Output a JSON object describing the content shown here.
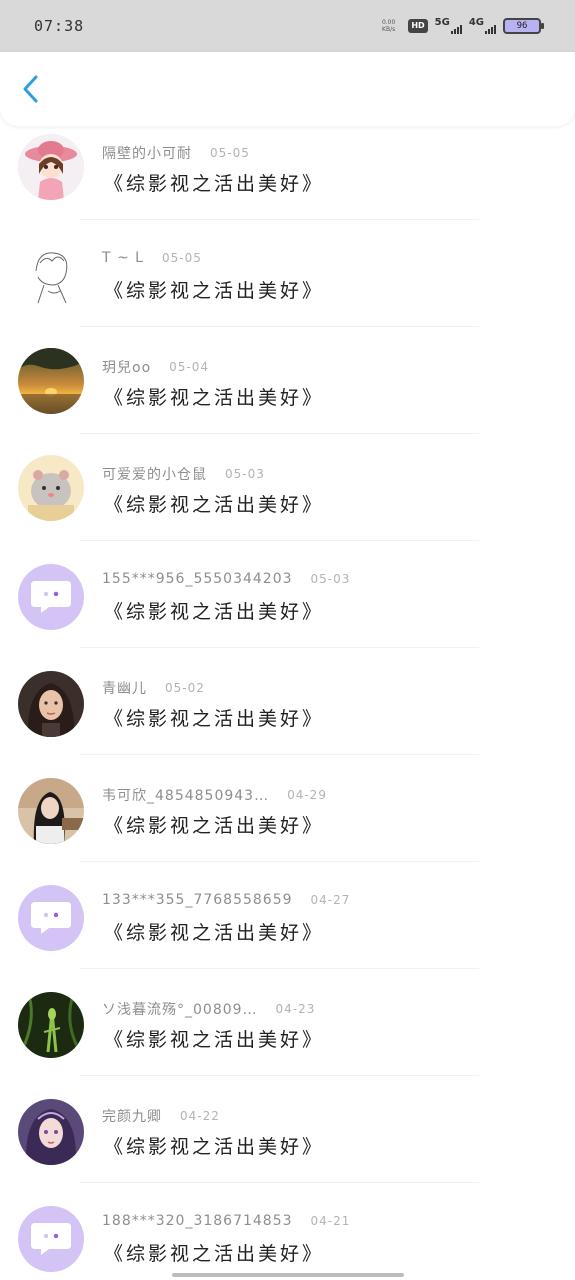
{
  "status_bar": {
    "time": "07:38",
    "net_speed_value": "0.00",
    "net_speed_unit": "KB/s",
    "hd_label": "HD",
    "signal1_label": "5G",
    "signal2_label": "4G",
    "battery": "96"
  },
  "header": {
    "back_icon": "chevron-left-icon",
    "accent_color": "#2a9fe0"
  },
  "items": [
    {
      "username": "隔壁的小可耐",
      "date": "05-05",
      "title": "《综影视之活出美好》",
      "avatar": "cartoon-girl-hat"
    },
    {
      "username": "T ~ L",
      "date": "05-05",
      "title": "《综影视之活出美好》",
      "avatar": "line-sketch-boy"
    },
    {
      "username": "玥兒oo",
      "date": "05-04",
      "title": "《综影视之活出美好》",
      "avatar": "sunset-lake"
    },
    {
      "username": "可爱爱的小仓鼠",
      "date": "05-03",
      "title": "《综影视之活出美好》",
      "avatar": "hamster"
    },
    {
      "username": "155***956_5550344203",
      "date": "05-03",
      "title": "《综影视之活出美好》",
      "avatar": "default-chat-bubble"
    },
    {
      "username": "青幽儿",
      "date": "05-02",
      "title": "《综影视之活出美好》",
      "avatar": "woman-portrait"
    },
    {
      "username": "韦可欣_4854850943…",
      "date": "04-29",
      "title": "《综影视之活出美好》",
      "avatar": "girl-selfie"
    },
    {
      "username": "133***355_7768558659",
      "date": "04-27",
      "title": "《综影视之活出美好》",
      "avatar": "default-chat-bubble"
    },
    {
      "username": "ソ浅暮流殇°_00809…",
      "date": "04-23",
      "title": "《综影视之活出美好》",
      "avatar": "mantis-green"
    },
    {
      "username": "完颜九卿",
      "date": "04-22",
      "title": "《综影视之活出美好》",
      "avatar": "anime-girl-purple"
    },
    {
      "username": "188***320_3186714853",
      "date": "04-21",
      "title": "《综影视之活出美好》",
      "avatar": "default-chat-bubble"
    }
  ]
}
